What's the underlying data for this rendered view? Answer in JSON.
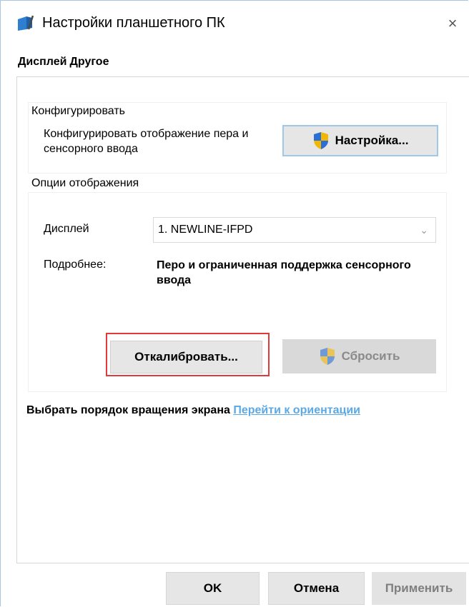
{
  "window": {
    "title": "Настройки планшетного ПК",
    "close_glyph": "×"
  },
  "tabs": [
    {
      "label": "Дисплей",
      "active": true
    },
    {
      "label": "Другое",
      "active": false
    }
  ],
  "configure": {
    "group_label": "Конфигурировать",
    "description": "Конфигурировать отображение пера и сенсорного ввода",
    "setup_button": "Настройка..."
  },
  "display_options": {
    "group_label": "Опции отображения",
    "display_label": "Дисплей",
    "display_value": "1. NEWLINE-IFPD",
    "details_label": "Подробнее:",
    "details_value": "Перо и ограниченная поддержка сенсорного ввода",
    "calibrate_button": "Откалибровать...",
    "reset_button": "Сбросить"
  },
  "rotation": {
    "text": "Выбрать порядок вращения экрана",
    "link": "Перейти к ориентации"
  },
  "footer": {
    "ok": "OK",
    "cancel": "Отмена",
    "apply": "Применить"
  },
  "colors": {
    "link": "#5aa8e6",
    "highlight": "#e03a3a",
    "focus_border": "#9ec7ea"
  },
  "icons": {
    "app": "tablet-pen-icon",
    "shield": "uac-shield-icon",
    "chevron": "chevron-down-icon"
  }
}
